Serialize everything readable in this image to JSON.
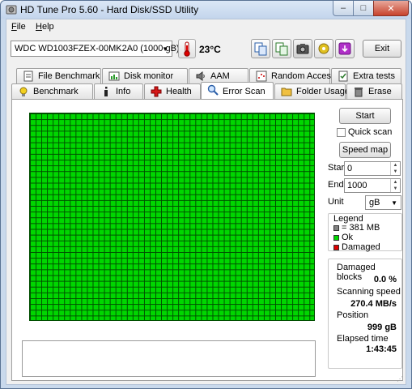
{
  "window": {
    "title": "HD Tune Pro 5.60 - Hard Disk/SSD Utility",
    "buttons": {
      "minimize": "–",
      "maximize": "□",
      "close": "✕"
    }
  },
  "menu": {
    "file": "File",
    "help": "Help"
  },
  "toolbar": {
    "drive": "WDC WD1003FZEX-00MK2A0 (1000 gB)",
    "temperature": "23°C",
    "exit_label": "Exit",
    "icons": [
      "copy-text-icon",
      "copy-info-icon",
      "screenshot-icon",
      "options-icon",
      "save-icon"
    ]
  },
  "tabs": {
    "row1": [
      "File Benchmark",
      "Disk monitor",
      "AAM",
      "Random Access",
      "Extra tests"
    ],
    "row2": [
      "Benchmark",
      "Info",
      "Health",
      "Error Scan",
      "Folder Usage",
      "Erase"
    ],
    "active": "Error Scan"
  },
  "error_scan": {
    "start_button": "Start",
    "quick_scan_label": "Quick scan",
    "quick_scan_checked": false,
    "speed_map_button": "Speed map",
    "start_label": "Start",
    "start_value": "0",
    "end_label": "End",
    "end_value": "1000",
    "unit_label": "Unit",
    "unit_value": "gB",
    "legend": {
      "title": "Legend",
      "block_size": "= 381 MB",
      "ok": "Ok",
      "damaged": "Damaged"
    },
    "stats": {
      "damaged_blocks_label": "Damaged blocks",
      "damaged_blocks_value": "0.0 %",
      "scanning_speed_label": "Scanning speed",
      "scanning_speed_value": "270.4 MB/s",
      "position_label": "Position",
      "position_value": "999 gB",
      "elapsed_time_label": "Elapsed time",
      "elapsed_time_value": "1:43:45"
    }
  },
  "colors": {
    "block_ok": "#00d600",
    "block_grid": "#004d00",
    "block_damaged": "#e00000",
    "block_unscanned": "#808080"
  }
}
